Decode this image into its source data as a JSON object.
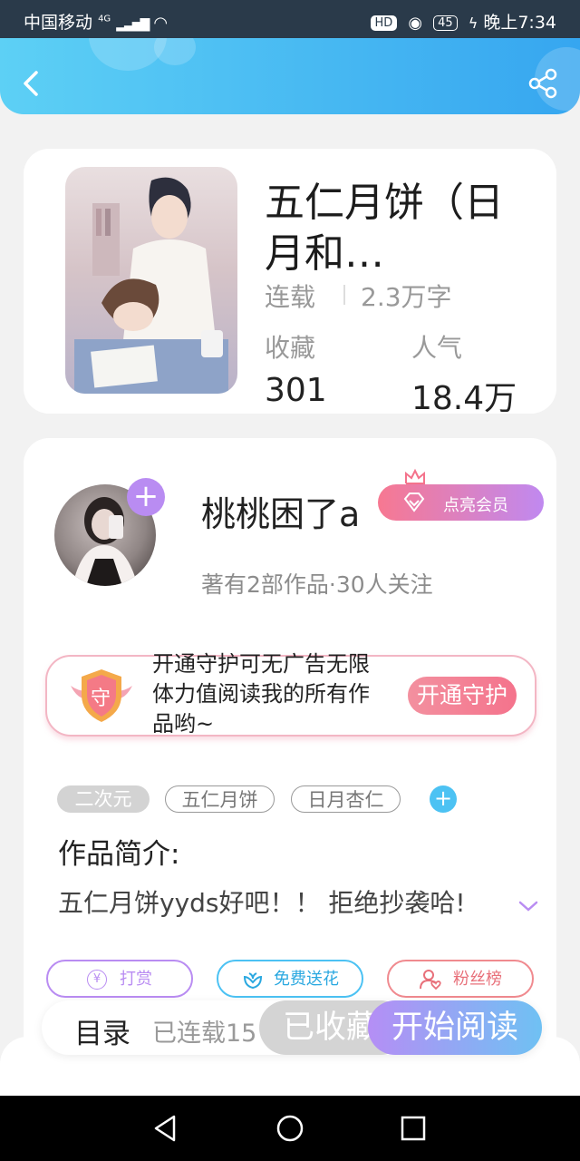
{
  "status_bar": {
    "carrier": "中国移动",
    "network": "4G",
    "hd": "HD",
    "battery": "45",
    "time": "晚上7:34"
  },
  "book": {
    "title": "五仁月饼（日月和…",
    "status": "连载",
    "words": "2.3万字",
    "favorites_label": "收藏",
    "favorites_value": "301",
    "popularity_label": "人气",
    "popularity_value": "18.4万"
  },
  "author": {
    "name": "桃桃困了a",
    "vip_label": "点亮会员",
    "meta": "著有2部作品·30人关注"
  },
  "guard": {
    "icon_char": "守",
    "text": "开通守护可无广告无限体力值阅读我的所有作品哟~",
    "button": "开通守护"
  },
  "tags": [
    "二次元",
    "五仁月饼",
    "日月杏仁"
  ],
  "intro": {
    "heading": "作品简介:",
    "text": "五仁月饼yyds好吧！！ 拒绝抄袭哈!"
  },
  "actions": {
    "reward": "打赏",
    "reward_icon": "¥",
    "flower": "免费送花",
    "fans": "粉丝榜"
  },
  "bottom": {
    "toc": "目录",
    "serial": "已连载15",
    "collected": "已收藏",
    "read": "开始阅读"
  },
  "colors": {
    "header_start": "#5dd0f5",
    "header_end": "#36a6f0",
    "accent_purple": "#b98cf2",
    "accent_pink": "#f4738c"
  }
}
